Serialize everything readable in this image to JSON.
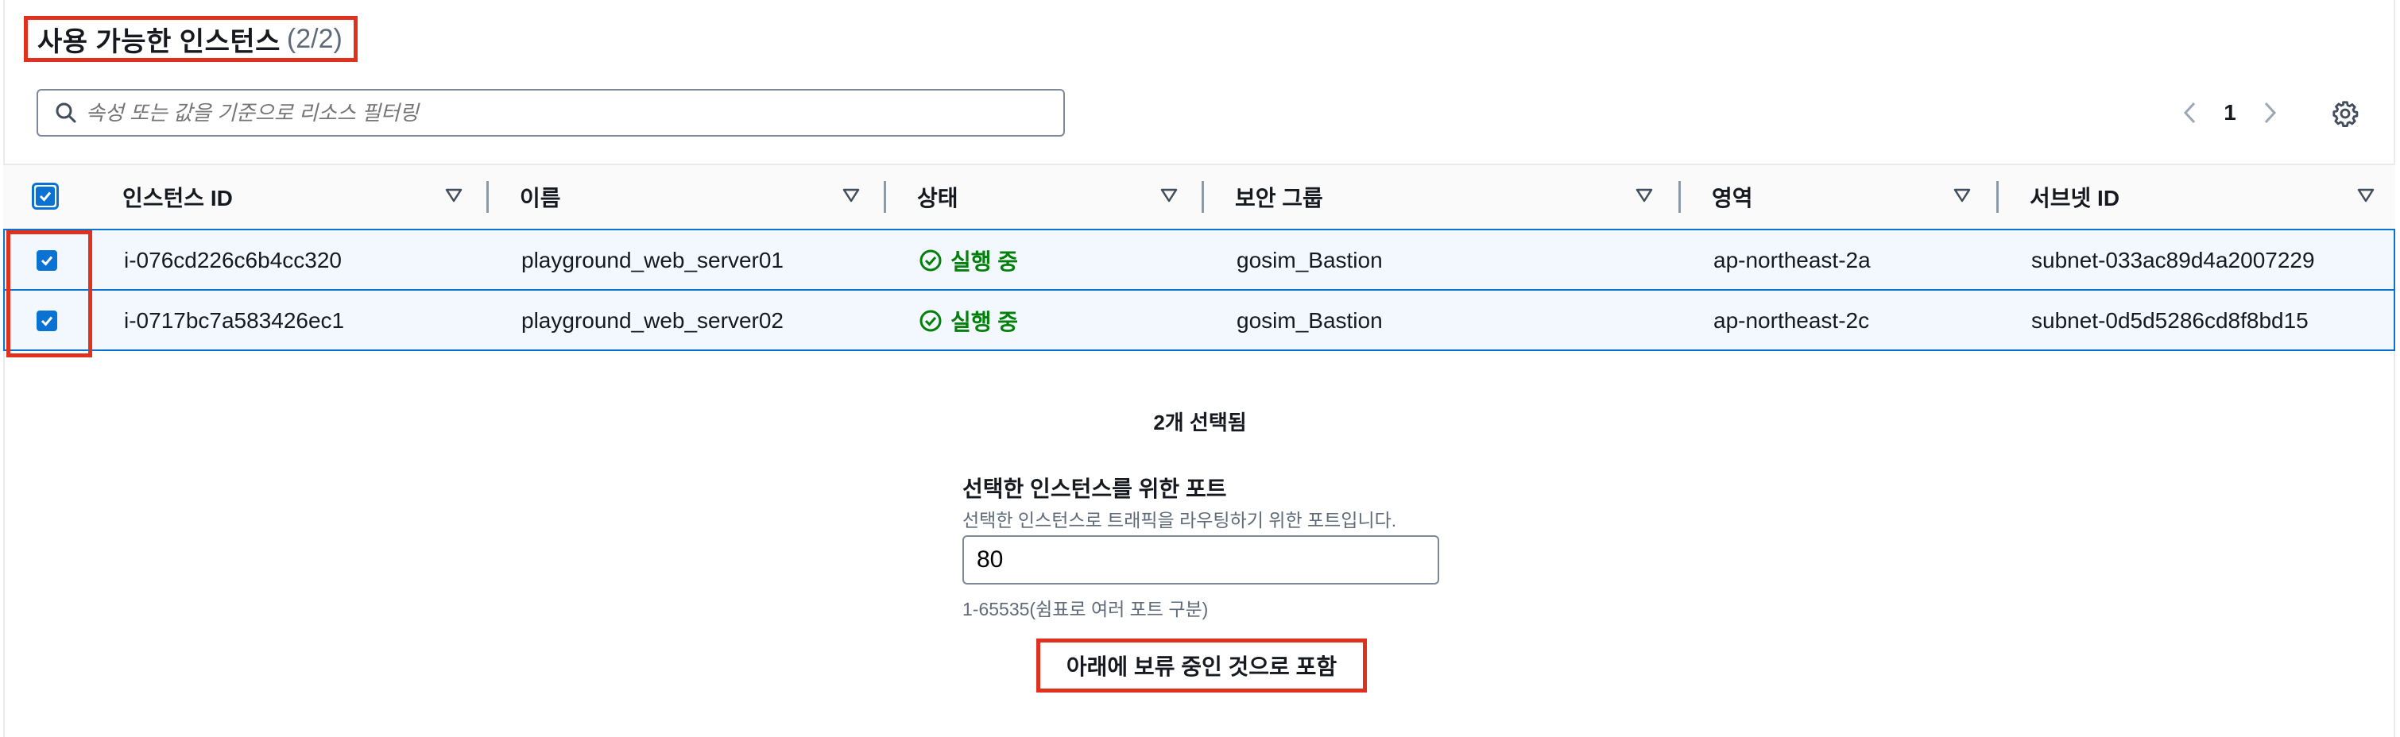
{
  "header": {
    "title": "사용 가능한 인스턴스",
    "count": "(2/2)"
  },
  "search": {
    "placeholder": "속성 또는 값을 기준으로 리소스 필터링"
  },
  "pagination": {
    "current_page": "1"
  },
  "table": {
    "columns": [
      "인스턴스 ID",
      "이름",
      "상태",
      "보안 그룹",
      "영역",
      "서브넷 ID"
    ],
    "rows": [
      {
        "selected": true,
        "instance_id": "i-076cd226c6b4cc320",
        "name": "playground_web_server01",
        "status": "실행 중",
        "security_group": "gosim_Bastion",
        "zone": "ap-northeast-2a",
        "subnet_id": "subnet-033ac89d4a2007229"
      },
      {
        "selected": true,
        "instance_id": "i-0717bc7a583426ec1",
        "name": "playground_web_server02",
        "status": "실행 중",
        "security_group": "gosim_Bastion",
        "zone": "ap-northeast-2c",
        "subnet_id": "subnet-0d5d5286cd8f8bd15"
      }
    ]
  },
  "selection": {
    "count_label": "2개 선택됨"
  },
  "port_form": {
    "label": "선택한 인스턴스를 위한 포트",
    "description": "선택한 인스턴스로 트래픽을 라우팅하기 위한 포트입니다.",
    "value": "80",
    "hint": "1-65535(쉼표로 여러 포트 구분)"
  },
  "actions": {
    "include_pending_label": "아래에 보류 중인 것으로 포함"
  },
  "colors": {
    "accent": "#0972d3",
    "highlight": "#e0301e",
    "success": "#037f0c"
  }
}
